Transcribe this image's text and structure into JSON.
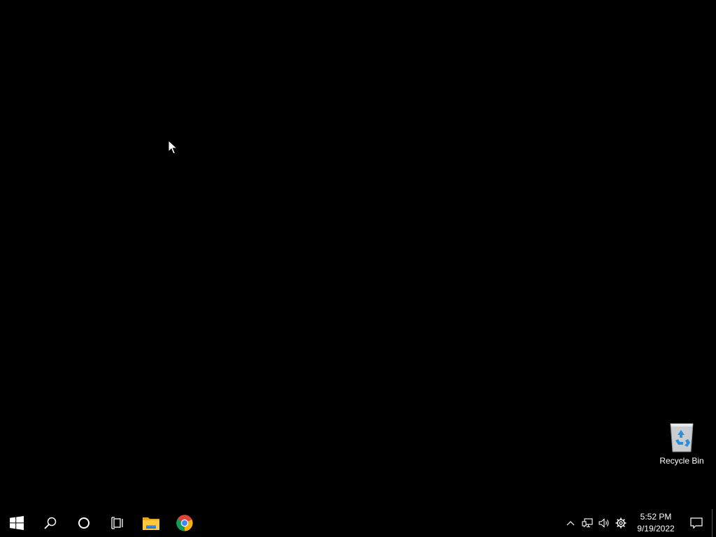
{
  "desktop": {
    "background_color": "#000000",
    "icons": [
      {
        "label": "Recycle Bin",
        "icon": "recycle-bin-icon"
      }
    ]
  },
  "taskbar": {
    "background_color": "#000000",
    "items": [
      {
        "name": "start",
        "icon": "windows-logo-icon"
      },
      {
        "name": "search",
        "icon": "search-icon"
      },
      {
        "name": "cortana",
        "icon": "cortana-circle-icon"
      },
      {
        "name": "task-view",
        "icon": "task-view-icon"
      },
      {
        "name": "file-explorer",
        "icon": "folder-icon"
      },
      {
        "name": "google-chrome",
        "icon": "chrome-icon"
      }
    ],
    "tray": {
      "icons": [
        "chevron-up-icon",
        "network-icon",
        "volume-icon",
        "gear-icon"
      ],
      "time": "5:52 PM",
      "date": "9/19/2022",
      "notification_icon": "notification-icon"
    }
  }
}
